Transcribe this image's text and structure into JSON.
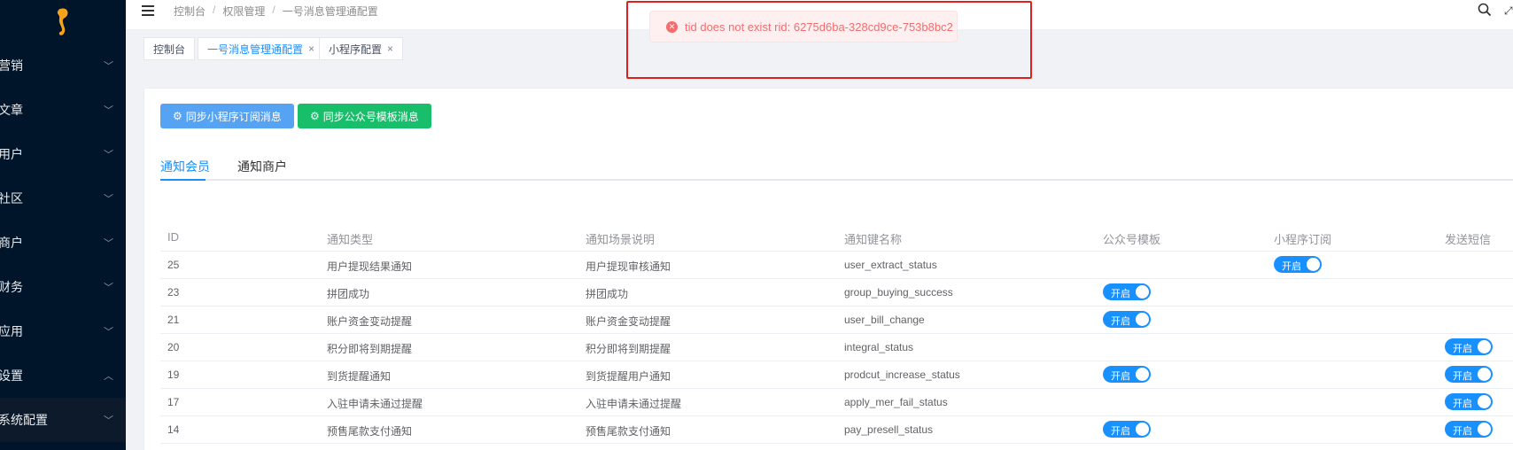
{
  "sidebar": {
    "logo": "seahorse-logo",
    "items": [
      {
        "label": "营销",
        "chevron": "chevron-down"
      },
      {
        "label": "文章",
        "chevron": "chevron-down"
      },
      {
        "label": "用户",
        "chevron": "chevron-down"
      },
      {
        "label": "社区",
        "chevron": "chevron-down"
      },
      {
        "label": "商户",
        "chevron": "chevron-down"
      },
      {
        "label": "财务",
        "chevron": "chevron-down"
      },
      {
        "label": "应用",
        "chevron": "chevron-down"
      },
      {
        "label": "设置",
        "chevron": "chevron-up"
      },
      {
        "label": "系统配置",
        "chevron": "chevron-down"
      }
    ]
  },
  "topbar": {
    "breadcrumb": [
      "控制台",
      "权限管理",
      "一号消息管理通配置"
    ],
    "separator": "/"
  },
  "tags": [
    {
      "label": "控制台",
      "closable": false
    },
    {
      "label": "一号消息管理通配置",
      "closable": true
    },
    {
      "label": "小程序配置",
      "closable": true
    }
  ],
  "message": {
    "type": "error",
    "text": "tid does not exist rid: 6275d6ba-328cd9ce-753b8bc2"
  },
  "buttons": {
    "sync_mini": "同步小程序订阅消息",
    "sync_official": "同步公众号模板消息"
  },
  "tabs": [
    "通知会员",
    "通知商户"
  ],
  "table": {
    "headers": [
      "ID",
      "通知类型",
      "通知场景说明",
      "通知键名称",
      "公众号模板",
      "小程序订阅",
      "发送短信"
    ],
    "switch_label": "开启",
    "rows": [
      {
        "id": "25",
        "type": "用户提现结果通知",
        "desc": "用户提现审核通知",
        "key": "user_extract_status",
        "wechat": false,
        "mini": true,
        "sms": false
      },
      {
        "id": "23",
        "type": "拼团成功",
        "desc": "拼团成功",
        "key": "group_buying_success",
        "wechat": true,
        "mini": false,
        "sms": false
      },
      {
        "id": "21",
        "type": "账户资金变动提醒",
        "desc": "账户资金变动提醒",
        "key": "user_bill_change",
        "wechat": true,
        "mini": false,
        "sms": false
      },
      {
        "id": "20",
        "type": "积分即将到期提醒",
        "desc": "积分即将到期提醒",
        "key": "integral_status",
        "wechat": false,
        "mini": false,
        "sms": true
      },
      {
        "id": "19",
        "type": "到货提醒通知",
        "desc": "到货提醒用户通知",
        "key": "prodcut_increase_status",
        "wechat": true,
        "mini": false,
        "sms": true
      },
      {
        "id": "17",
        "type": "入驻申请未通过提醒",
        "desc": "入驻申请未通过提醒",
        "key": "apply_mer_fail_status",
        "wechat": false,
        "mini": false,
        "sms": true
      },
      {
        "id": "14",
        "type": "预售尾款支付通知",
        "desc": "预售尾款支付通知",
        "key": "pay_presell_status",
        "wechat": true,
        "mini": false,
        "sms": true
      }
    ]
  },
  "colors": {
    "sidebar_bg": "#001529",
    "primary": "#1890ff",
    "success": "#19be6b",
    "error": "#f56c6c"
  }
}
